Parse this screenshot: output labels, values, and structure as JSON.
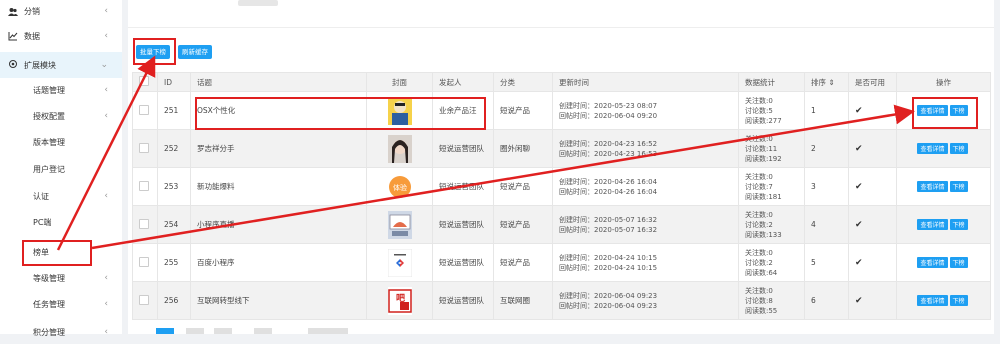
{
  "sidebar": {
    "items": [
      {
        "label": "分销",
        "icon": "users-icon",
        "level": "top",
        "chev": "‹"
      },
      {
        "label": "数据",
        "icon": "chart-line-icon",
        "level": "top",
        "chev": "‹"
      },
      {
        "label": "扩展模块",
        "icon": "gear-icon",
        "level": "top",
        "chev": "⌄"
      },
      {
        "label": "话题管理",
        "level": "sub",
        "chev": "‹"
      },
      {
        "label": "授权配置",
        "level": "sub",
        "chev": "‹"
      },
      {
        "label": "版本管理",
        "level": "sub",
        "chev": ""
      },
      {
        "label": "用户登记",
        "level": "sub",
        "chev": ""
      },
      {
        "label": "认证",
        "level": "sub",
        "chev": "‹"
      },
      {
        "label": "PC端",
        "level": "sub",
        "chev": ""
      },
      {
        "label": "榜单",
        "level": "sub",
        "chev": ""
      },
      {
        "label": "等级管理",
        "level": "sub",
        "chev": "‹"
      },
      {
        "label": "任务管理",
        "level": "sub",
        "chev": "‹"
      },
      {
        "label": "积分管理",
        "level": "sub",
        "chev": "‹"
      }
    ]
  },
  "toolbar": {
    "batch_label": "批量下榜",
    "refresh_label": "刷新缓存"
  },
  "table": {
    "headers": [
      "",
      "ID",
      "话题",
      "封面",
      "发起人",
      "分类",
      "更新时间",
      "数据统计",
      "排序 ⇕",
      "是否可用",
      "操作"
    ],
    "rows": [
      {
        "id": "251",
        "topic": "OSX个性化",
        "cover": "person-yellow",
        "author": "业余产品汪",
        "category": "短说产品",
        "created": "创建时间：2020-05-23 08:07",
        "replied": "回帖时间：2020-06-04 09:20",
        "follows": "关注数:0",
        "discuss": "讨论数:5",
        "reads": "阅读数:277",
        "sort": "1"
      },
      {
        "id": "252",
        "topic": "罗志祥分手",
        "cover": "portrait",
        "author": "短说运营团队",
        "category": "圈外闲聊",
        "created": "创建时间：2020-04-23 16:52",
        "replied": "回帖时间：2020-04-23 16:53",
        "follows": "关注数:0",
        "discuss": "讨论数:11",
        "reads": "阅读数:192",
        "sort": "2"
      },
      {
        "id": "253",
        "topic": "新功能爆料",
        "cover": "orange-badge",
        "author": "短说运营团队",
        "category": "短说产品",
        "created": "创建时间：2020-04-26 16:04",
        "replied": "回帖时间：2020-04-26 16:04",
        "follows": "关注数:0",
        "discuss": "讨论数:7",
        "reads": "阅读数:181",
        "sort": "3"
      },
      {
        "id": "254",
        "topic": "小程序直播",
        "cover": "screen-photo",
        "author": "短说运营团队",
        "category": "短说产品",
        "created": "创建时间：2020-05-07 16:32",
        "replied": "回帖时间：2020-05-07 16:32",
        "follows": "关注数:0",
        "discuss": "讨论数:2",
        "reads": "阅读数:133",
        "sort": "4"
      },
      {
        "id": "255",
        "topic": "百度小程序",
        "cover": "logo-card",
        "author": "短说运营团队",
        "category": "短说产品",
        "created": "创建时间：2020-04-24 10:15",
        "replied": "回帖时间：2020-04-24 10:15",
        "follows": "关注数:0",
        "discuss": "讨论数:2",
        "reads": "阅读数:64",
        "sort": "5"
      },
      {
        "id": "256",
        "topic": "互联网转型线下",
        "cover": "red-text",
        "author": "短说运营团队",
        "category": "互联网圈",
        "created": "创建时间：2020-06-04 09:23",
        "replied": "回帖时间：2020-06-04 09:23",
        "follows": "关注数:0",
        "discuss": "讨论数:8",
        "reads": "阅读数:55",
        "sort": "6"
      }
    ],
    "op_detail": "查看详情",
    "op_down": "下榜",
    "enabled_mark": "✔"
  },
  "cover_text": {
    "badge": "体验",
    "red": "吧"
  },
  "colors": {
    "accent": "#1e9ff2",
    "annotation": "#e02020"
  }
}
